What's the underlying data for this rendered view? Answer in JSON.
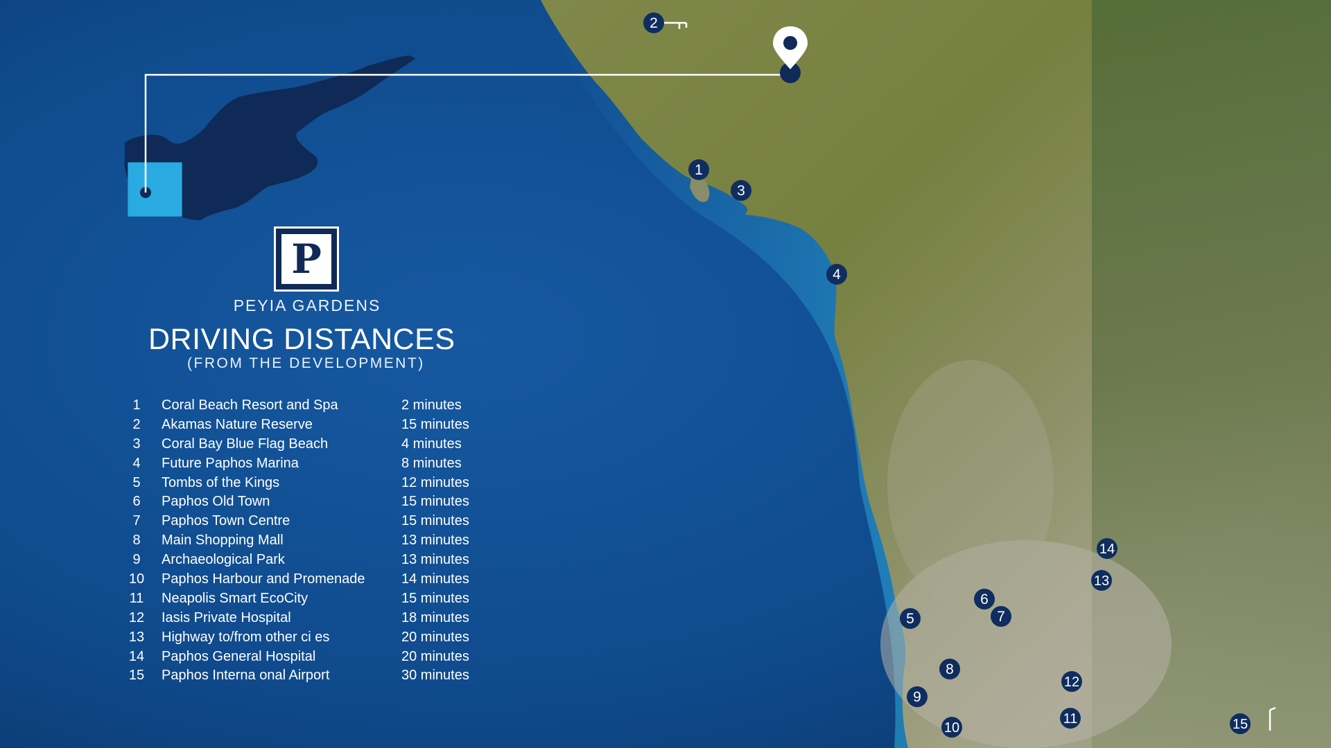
{
  "brand": {
    "name": "PEYIA GARDENS",
    "logo_letter": "P"
  },
  "heading": {
    "title": "DRIVING DISTANCES",
    "subtitle": "(FROM THE DEVELOPMENT)"
  },
  "distances": [
    {
      "num": "1",
      "name": "Coral Beach Resort and Spa",
      "time": "2   minutes"
    },
    {
      "num": "2",
      "name": "Akamas Nature Reserve",
      "time": "15 minutes"
    },
    {
      "num": "3",
      "name": "Coral Bay Blue Flag Beach",
      "time": "4   minutes"
    },
    {
      "num": "4",
      "name": "Future Paphos Marina",
      "time": "8   minutes"
    },
    {
      "num": "5",
      "name": "Tombs of the Kings",
      "time": "12 minutes"
    },
    {
      "num": "6",
      "name": "Paphos Old Town",
      "time": "15 minutes"
    },
    {
      "num": "7",
      "name": "Paphos Town Centre",
      "time": "15 minutes"
    },
    {
      "num": "8",
      "name": "Main Shopping Mall",
      "time": "13 minutes"
    },
    {
      "num": "9",
      "name": "Archaeological Park",
      "time": "13 minutes"
    },
    {
      "num": "10",
      "name": "Paphos Harbour and Promenade",
      "time": "14 minutes"
    },
    {
      "num": "11",
      "name": "Neapolis Smart EcoCity",
      "time": "15 minutes"
    },
    {
      "num": "12",
      "name": "Iasis Private Hospital",
      "time": "18 minutes"
    },
    {
      "num": "13",
      "name": "Highway to/from other ci es",
      "time": "20 minutes"
    },
    {
      "num": "14",
      "name": "Paphos General Hospital",
      "time": "20 minutes"
    },
    {
      "num": "15",
      "name": "Paphos Interna onal Airport",
      "time": "30 minutes"
    }
  ],
  "markers": [
    "1",
    "2",
    "3",
    "4",
    "5",
    "6",
    "7",
    "8",
    "9",
    "10",
    "11",
    "12",
    "13",
    "14",
    "15"
  ],
  "icons": {
    "location_pin": "map-pin-icon",
    "country_outline": "cyprus-silhouette"
  },
  "colors": {
    "sea": "#0d3f78",
    "land": "#6f7a43",
    "marker": "#0f2d5e",
    "island": "#0f2a57",
    "highlight": "#29abe2",
    "text": "#ffffff"
  }
}
